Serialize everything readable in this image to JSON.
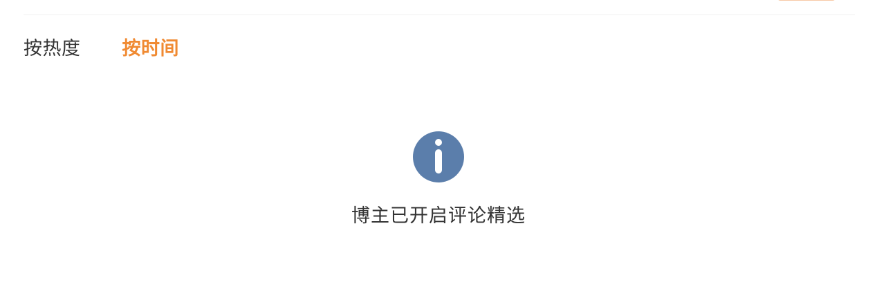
{
  "tabs": [
    {
      "label": "按热度",
      "active": false
    },
    {
      "label": "按时间",
      "active": true
    }
  ],
  "empty_state": {
    "icon": "info-icon",
    "message": "博主已开启评论精选"
  },
  "colors": {
    "accent": "#f08a32",
    "icon": "#5b7eab",
    "text": "#333333"
  }
}
